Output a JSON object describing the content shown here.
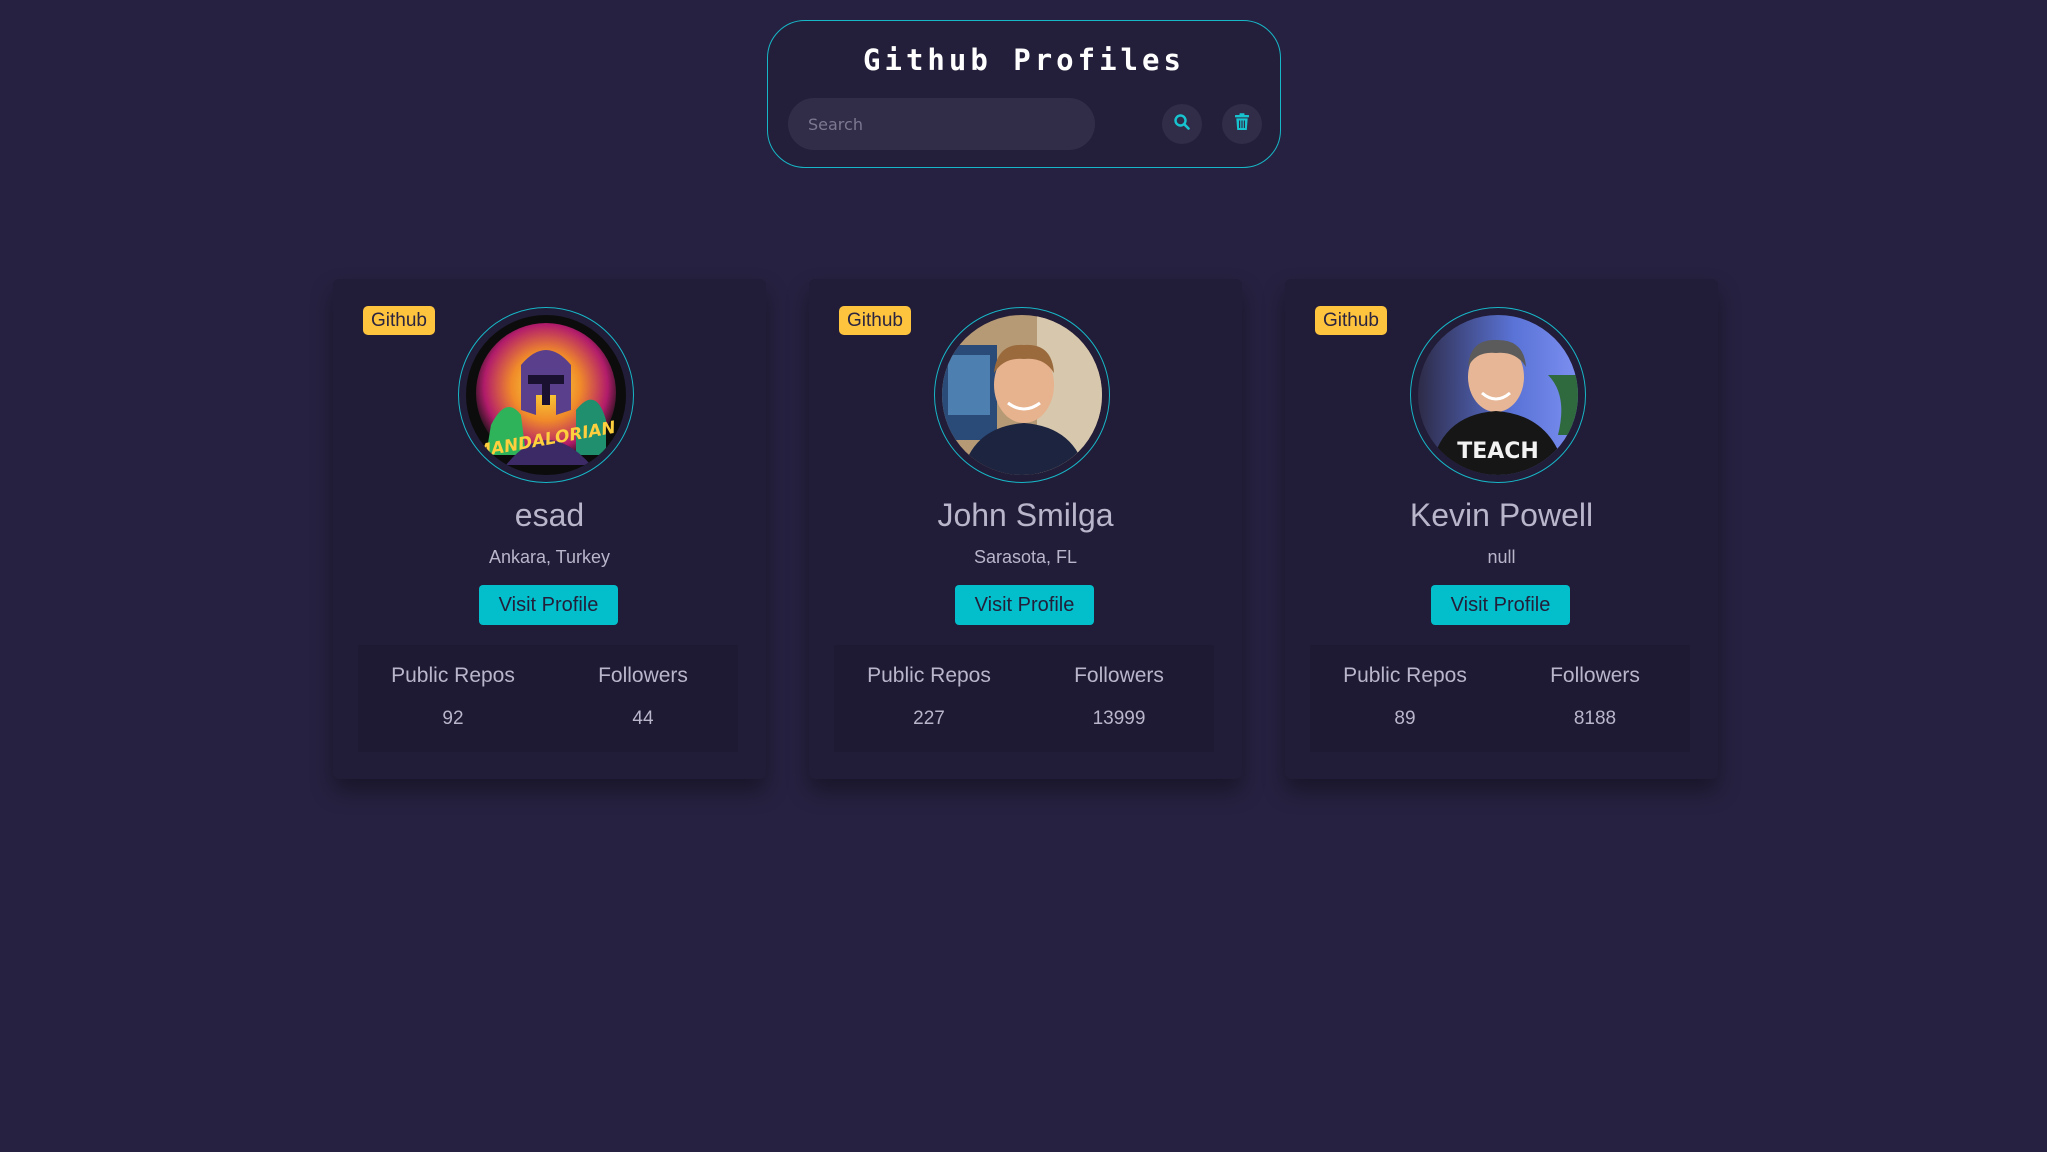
{
  "app": {
    "title": "Github Profiles"
  },
  "search": {
    "placeholder": "Search",
    "value": ""
  },
  "icons": {
    "search_button": "search-icon",
    "clear_button": "trash-icon"
  },
  "colors": {
    "background": "#262140",
    "accent": "#03bfcb",
    "badge": "#fec43e",
    "card": "#211c37"
  },
  "profiles": [
    {
      "badge": "Github",
      "name": "esad",
      "location": "Ankara, Turkey",
      "visit_label": "Visit Profile",
      "repos_label": "Public Repos",
      "repos": "92",
      "followers_label": "Followers",
      "followers": "44"
    },
    {
      "badge": "Github",
      "name": "John Smilga",
      "location": "Sarasota, FL",
      "visit_label": "Visit Profile",
      "repos_label": "Public Repos",
      "repos": "227",
      "followers_label": "Followers",
      "followers": "13999"
    },
    {
      "badge": "Github",
      "name": "Kevin Powell",
      "location": "null",
      "visit_label": "Visit Profile",
      "repos_label": "Public Repos",
      "repos": "89",
      "followers_label": "Followers",
      "followers": "8188"
    }
  ]
}
